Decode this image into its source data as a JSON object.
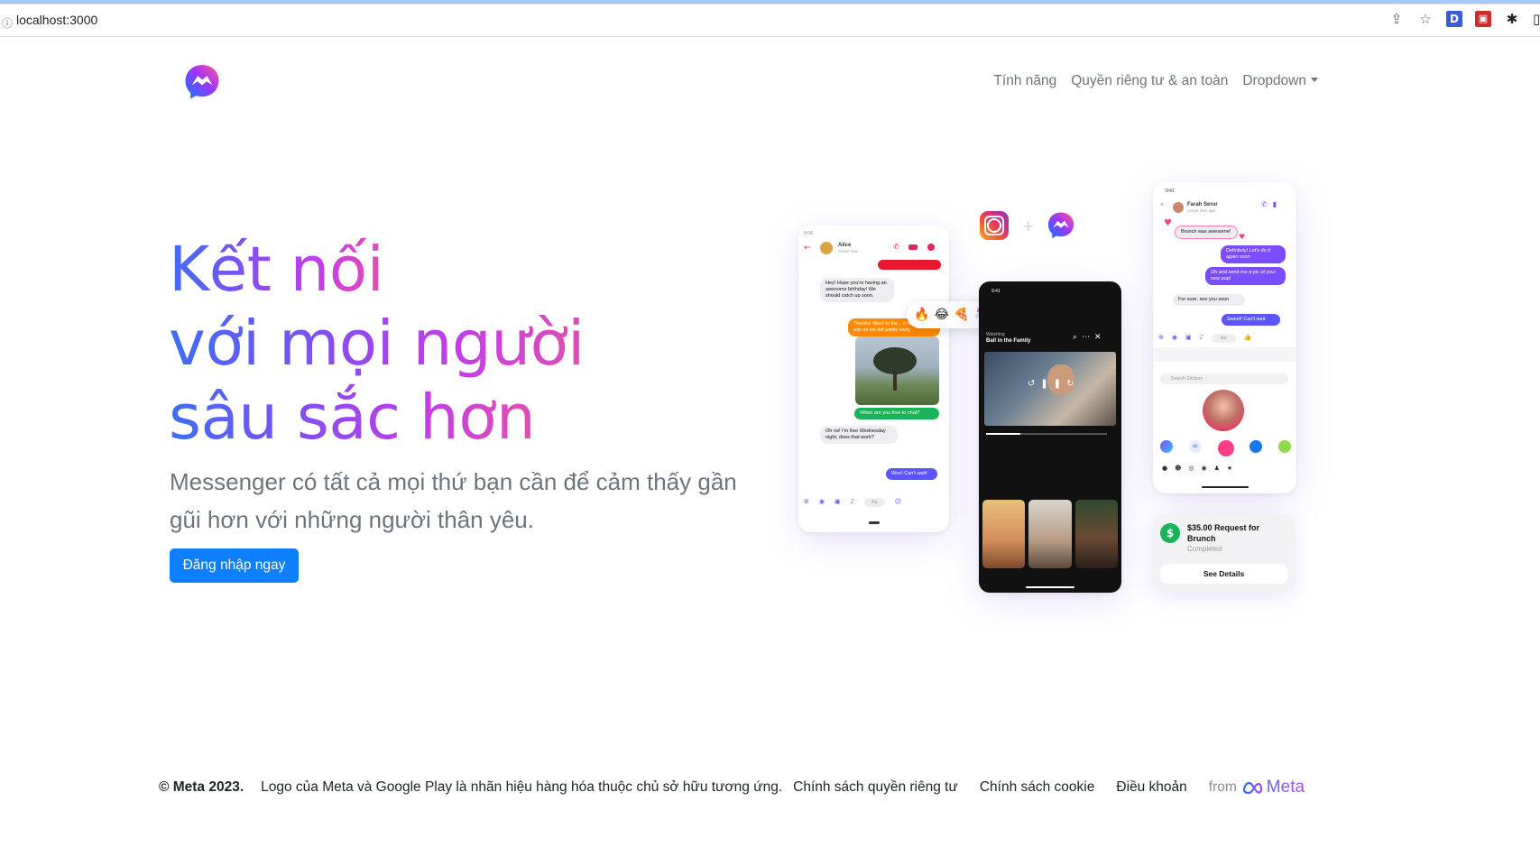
{
  "browser": {
    "url": "localhost:3000",
    "info_icon": "info-icon",
    "toolbar_icons": [
      "share-icon",
      "star-icon",
      "extension-d-icon",
      "extension-red-icon",
      "puzzle-icon",
      "sidebar-icon"
    ]
  },
  "navbar": {
    "logo": "messenger-logo",
    "items": [
      {
        "label": "Tính năng"
      },
      {
        "label": "Quyền riêng tư & an toàn"
      },
      {
        "label": "Dropdown"
      }
    ]
  },
  "hero": {
    "title_lines": [
      "Kết nối",
      "với mọi người",
      "sâu sắc hơn"
    ],
    "subtitle": "Messenger có tất cả mọi thứ bạn cần để cảm thấy gần gũi hơn với những người thân yêu.",
    "cta_label": "Đăng nhập ngay",
    "colors": {
      "gradient_start": "#3d6ef5",
      "gradient_mid": "#8a4cf0",
      "gradient_end": "#e14fb0",
      "cta": "#0d7fff"
    }
  },
  "mockups": {
    "phone1": {
      "time": "9:04",
      "contact": "Alice",
      "status": "Active now",
      "messages": [
        "Hey! Hope you're having an awesome birthday! We should catch up soon.",
        "Thanks! Went to the... it started to rain so we left pretty early.",
        "When are you free to chat?",
        "Oh no! I'm free Wednesday night, does that work?",
        "Woo! Can't wait!"
      ],
      "input_placeholder": "Aa"
    },
    "phone2": {
      "time": "9:41",
      "watching_label": "Watching",
      "show_title": "Ball in the Family"
    },
    "phone3": {
      "time": "9:41",
      "contact": "Farah Serur",
      "status": "Active 20m ago",
      "messages": [
        "Brunch was awesome!",
        "Definitely! Let's do it again soon",
        "Oh and send me a pic of your new pup!",
        "For sure, see you soon",
        "Sweet! Can't wait"
      ],
      "input_placeholder": "Aa",
      "search_placeholder": "Search Stickers"
    },
    "payment": {
      "title": "$35.00 Request for Brunch",
      "status": "Completed",
      "button": "See Details"
    }
  },
  "footer": {
    "copyright": "© Meta 2023.",
    "disclaimer": "Logo của Meta và Google Play là nhãn hiệu hàng hóa thuộc chủ sở hữu tương ứng.",
    "links": [
      "Chính sách quyền riêng tư",
      "Chính sách cookie",
      "Điều khoản"
    ],
    "from_label": "from",
    "brand": "Meta"
  }
}
